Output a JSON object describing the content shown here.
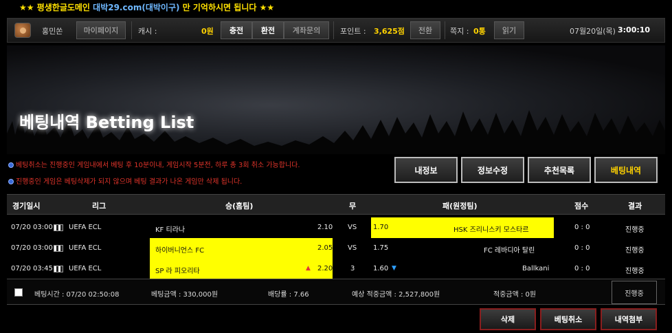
{
  "topbar": {
    "prefix": "★★ 평생한글도메인 ",
    "url": "대박29.com(대박이구)",
    "suffix": " 만 기억하시면 됩니다 ★★"
  },
  "infobar": {
    "username": "홍민쏜",
    "mypage": "마이페이지",
    "cash_label": "캐시 :",
    "cash_value": "0원",
    "charge": "충전",
    "exchange": "환전",
    "account_inquiry": "계좌문의",
    "point_label": "포인트 :",
    "point_value": "3,625점",
    "convert": "전환",
    "note_label": "쪽지 :",
    "note_value": "0통",
    "read": "읽기",
    "date": "07월20일(목)",
    "time": "3:00:10"
  },
  "banner": {
    "title": "베팅내역 Betting List"
  },
  "notices": [
    "베팅취소는 진행중인 게임내에서 베팅 후 10분이내, 게임시작 5분전, 하루 총 3회 취소 가능합니다.",
    "진행중인 게임은 베팅삭제가 되지 않으며 베팅 결과가 나온 게임만 삭제 됩니다."
  ],
  "tabs": [
    "내정보",
    "정보수정",
    "추천목록",
    "베팅내역"
  ],
  "table": {
    "headers": [
      "경기일시",
      "리그",
      "승(홈팀)",
      "무",
      "패(원정팀)",
      "점수",
      "결과"
    ],
    "rows": [
      {
        "datetime": "07/20 03:00",
        "league": "UEFA ECL",
        "home": "KF 티라나",
        "home_odds": "2.10",
        "draw": "VS",
        "away_odds": "1.70",
        "away": "HSK 즈리니스키 모스타르",
        "score": "0 : 0",
        "result": "진행중"
      },
      {
        "datetime": "07/20 03:00",
        "league": "UEFA ECL",
        "home": "하이버니언스 FC",
        "home_odds": "2.05",
        "draw": "VS",
        "away_odds": "1.75",
        "away": "FC 레바디아 탈린",
        "score": "0 : 0",
        "result": "진행중"
      },
      {
        "datetime": "07/20 03:45",
        "league": "UEFA ECL",
        "home": "SP 라 피오리타",
        "home_odds": "2.20",
        "draw": "3",
        "away_odds": "1.60",
        "away": "Ballkani",
        "score": "0 : 0",
        "result": "진행중"
      }
    ]
  },
  "footer": {
    "bet_time": "베팅시간 : 07/20 02:50:08",
    "bet_amount": "베팅금액 : 330,000원",
    "odds": "배당률 : 7.66",
    "expected": "예상 적중금액 : 2,527,800원",
    "won": "적중금액 : 0원",
    "status": "진행중"
  },
  "actions": [
    "삭제",
    "베팅취소",
    "내역첨부"
  ],
  "colors": {
    "highlight": "#ffff00",
    "accent_yellow": "#ffd200",
    "notice_red": "#e0342a"
  }
}
